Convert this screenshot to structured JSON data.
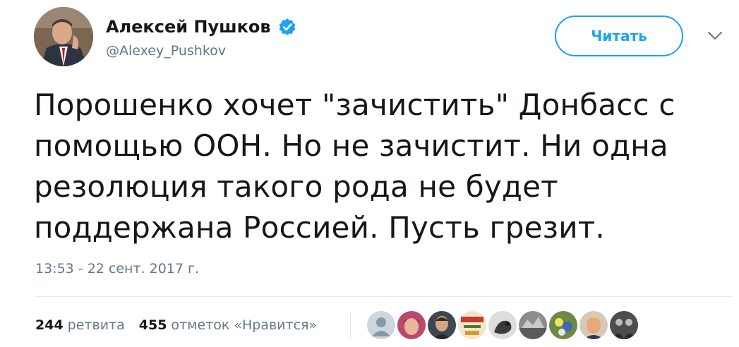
{
  "author": {
    "name": "Алексей Пушков",
    "handle": "@Alexey_Pushkov"
  },
  "follow_button": {
    "label": "Читать"
  },
  "tweet": {
    "lines": [
      "Порошенко хочет \"зачистить\" Донбасс с",
      "помощью ООН. Но не зачистит. Ни одна",
      "резолюция такого рода не будет",
      "поддержана Россией. Пусть грезит."
    ],
    "timestamp": "13:53 - 22 сент. 2017 г."
  },
  "stats": {
    "retweets": {
      "count": "244",
      "label": "ретвита"
    },
    "likes": {
      "count": "455",
      "label": "отметок «Нравится»"
    }
  },
  "colors": {
    "accent": "#1da1f2",
    "text": "#14171a",
    "secondary": "#657786",
    "divider": "#e6ecf0"
  },
  "icons": [
    "verified-badge-icon",
    "chevron-down-icon",
    "default-avatar-icon"
  ]
}
